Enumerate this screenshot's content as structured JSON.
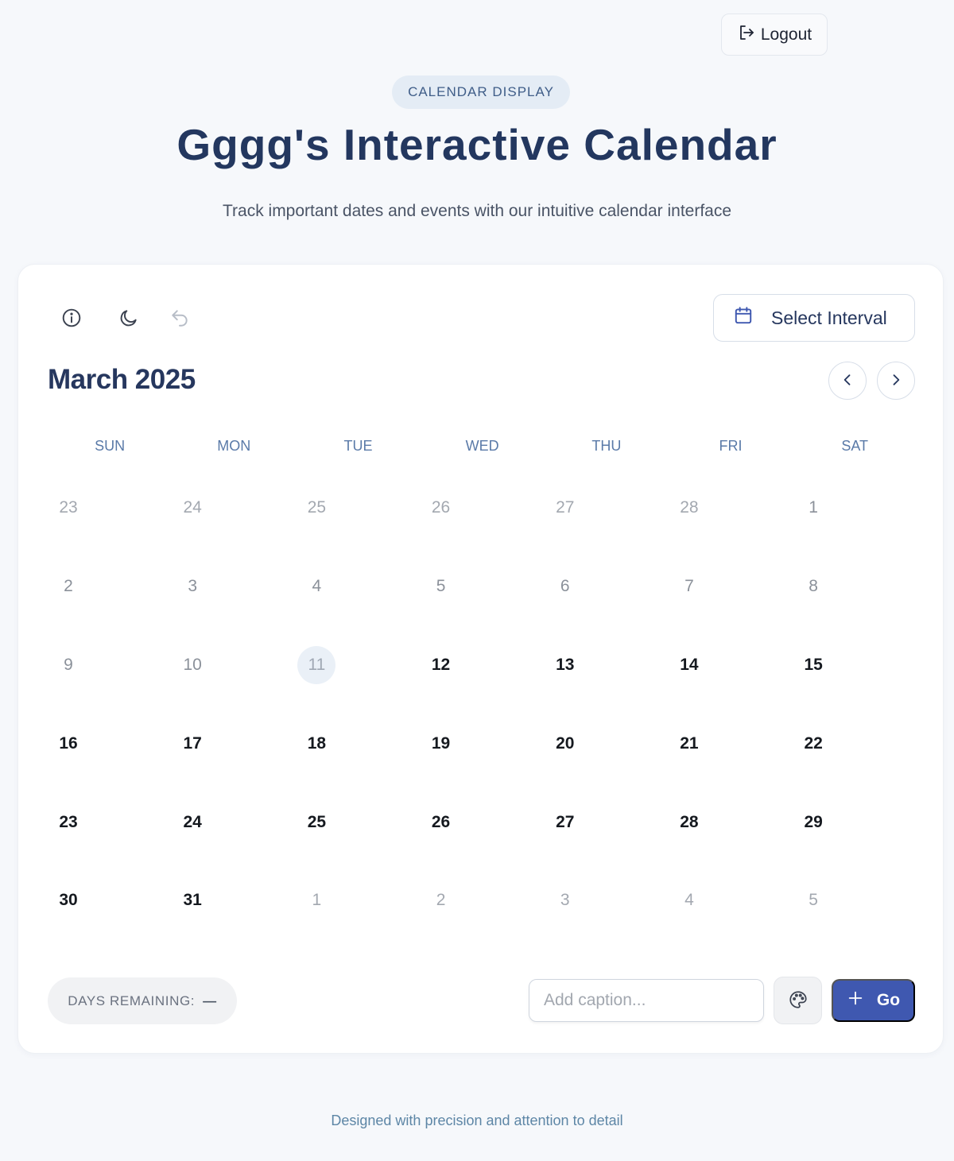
{
  "header": {
    "logout_label": "Logout",
    "pill_label": "CALENDAR DISPLAY",
    "title": "Gggg's Interactive Calendar",
    "subtitle": "Track important dates and events with our intuitive calendar interface"
  },
  "toolbar": {
    "info_icon": "info-icon",
    "theme_icon": "moon-icon",
    "undo_icon": "undo-icon",
    "select_interval_label": "Select Interval"
  },
  "calendar": {
    "month_title": "March 2025",
    "weekdays": [
      "SUN",
      "MON",
      "TUE",
      "WED",
      "THU",
      "FRI",
      "SAT"
    ],
    "days": [
      {
        "n": "23",
        "state": "other"
      },
      {
        "n": "24",
        "state": "other"
      },
      {
        "n": "25",
        "state": "other"
      },
      {
        "n": "26",
        "state": "other"
      },
      {
        "n": "27",
        "state": "other"
      },
      {
        "n": "28",
        "state": "other"
      },
      {
        "n": "1",
        "state": "past"
      },
      {
        "n": "2",
        "state": "past"
      },
      {
        "n": "3",
        "state": "past"
      },
      {
        "n": "4",
        "state": "past"
      },
      {
        "n": "5",
        "state": "past"
      },
      {
        "n": "6",
        "state": "past"
      },
      {
        "n": "7",
        "state": "past"
      },
      {
        "n": "8",
        "state": "past"
      },
      {
        "n": "9",
        "state": "past"
      },
      {
        "n": "10",
        "state": "past"
      },
      {
        "n": "11",
        "state": "today"
      },
      {
        "n": "12",
        "state": "current"
      },
      {
        "n": "13",
        "state": "current"
      },
      {
        "n": "14",
        "state": "current"
      },
      {
        "n": "15",
        "state": "current"
      },
      {
        "n": "16",
        "state": "current"
      },
      {
        "n": "17",
        "state": "current"
      },
      {
        "n": "18",
        "state": "current"
      },
      {
        "n": "19",
        "state": "current"
      },
      {
        "n": "20",
        "state": "current"
      },
      {
        "n": "21",
        "state": "current"
      },
      {
        "n": "22",
        "state": "current"
      },
      {
        "n": "23",
        "state": "current"
      },
      {
        "n": "24",
        "state": "current"
      },
      {
        "n": "25",
        "state": "current"
      },
      {
        "n": "26",
        "state": "current"
      },
      {
        "n": "27",
        "state": "current"
      },
      {
        "n": "28",
        "state": "current"
      },
      {
        "n": "29",
        "state": "current"
      },
      {
        "n": "30",
        "state": "current"
      },
      {
        "n": "31",
        "state": "current"
      },
      {
        "n": "1",
        "state": "other"
      },
      {
        "n": "2",
        "state": "other"
      },
      {
        "n": "3",
        "state": "other"
      },
      {
        "n": "4",
        "state": "other"
      },
      {
        "n": "5",
        "state": "other"
      }
    ]
  },
  "bottom_bar": {
    "days_remaining_label": "DAYS REMAINING:",
    "days_remaining_value": "—",
    "caption_placeholder": "Add caption...",
    "caption_value": "",
    "go_label": "Go"
  },
  "footer": {
    "text": "Designed with precision and attention to detail"
  },
  "colors": {
    "accent": "#3f58b0",
    "title": "#23375f",
    "weekday": "#5a7aa8"
  }
}
